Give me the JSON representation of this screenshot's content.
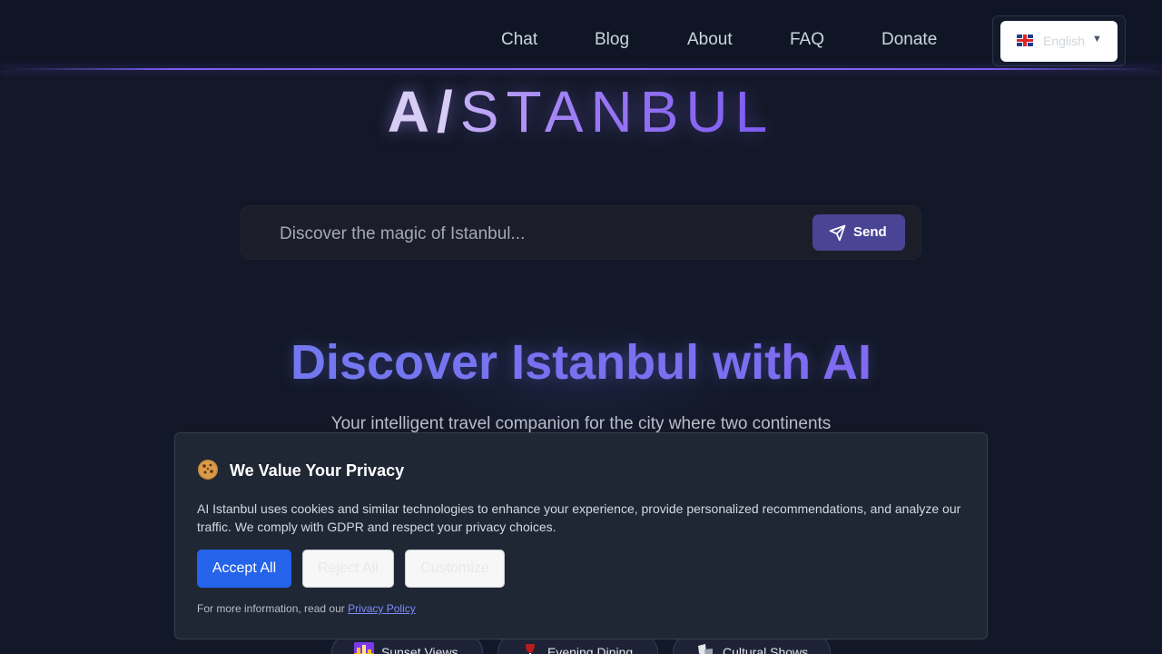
{
  "header": {
    "nav": [
      {
        "label": "Chat"
      },
      {
        "label": "Blog"
      },
      {
        "label": "About"
      },
      {
        "label": "FAQ"
      },
      {
        "label": "Donate"
      }
    ],
    "language": {
      "selected": "English",
      "flag": "uk-flag-icon",
      "caret": "▼"
    }
  },
  "logo": {
    "prefix": "A/",
    "rest": "STANBUL"
  },
  "search": {
    "placeholder": "Discover the magic of Istanbul...",
    "value": "",
    "send_label": "Send",
    "send_icon": "paper-plane-icon"
  },
  "hero": {
    "title": "Discover Istanbul with AI",
    "subtitle": "Your intelligent travel companion for the city where two continents"
  },
  "pills": [
    {
      "label": "Sunset Views",
      "icon": "cityscape-icon"
    },
    {
      "label": "Evening Dining",
      "icon": "wine-glass-icon"
    },
    {
      "label": "Cultural Shows",
      "icon": "masks-icon"
    }
  ],
  "cookie": {
    "icon": "cookie-icon",
    "title": "We Value Your Privacy",
    "text": "AI Istanbul uses cookies and similar technologies to enhance your experience, provide personalized recommendations, and analyze our traffic. We comply with GDPR and respect your privacy choices.",
    "accept_label": "Accept All",
    "reject_label": "Reject All",
    "customize_label": "Customize",
    "footer_prefix": "For more information, read our",
    "footer_link": "Privacy Policy"
  },
  "colors": {
    "background": "#121827",
    "accent_purple": "#7c5cf6",
    "send_button": "#4a4494",
    "accept_button": "#2563eb",
    "banner": "#1f2735"
  }
}
